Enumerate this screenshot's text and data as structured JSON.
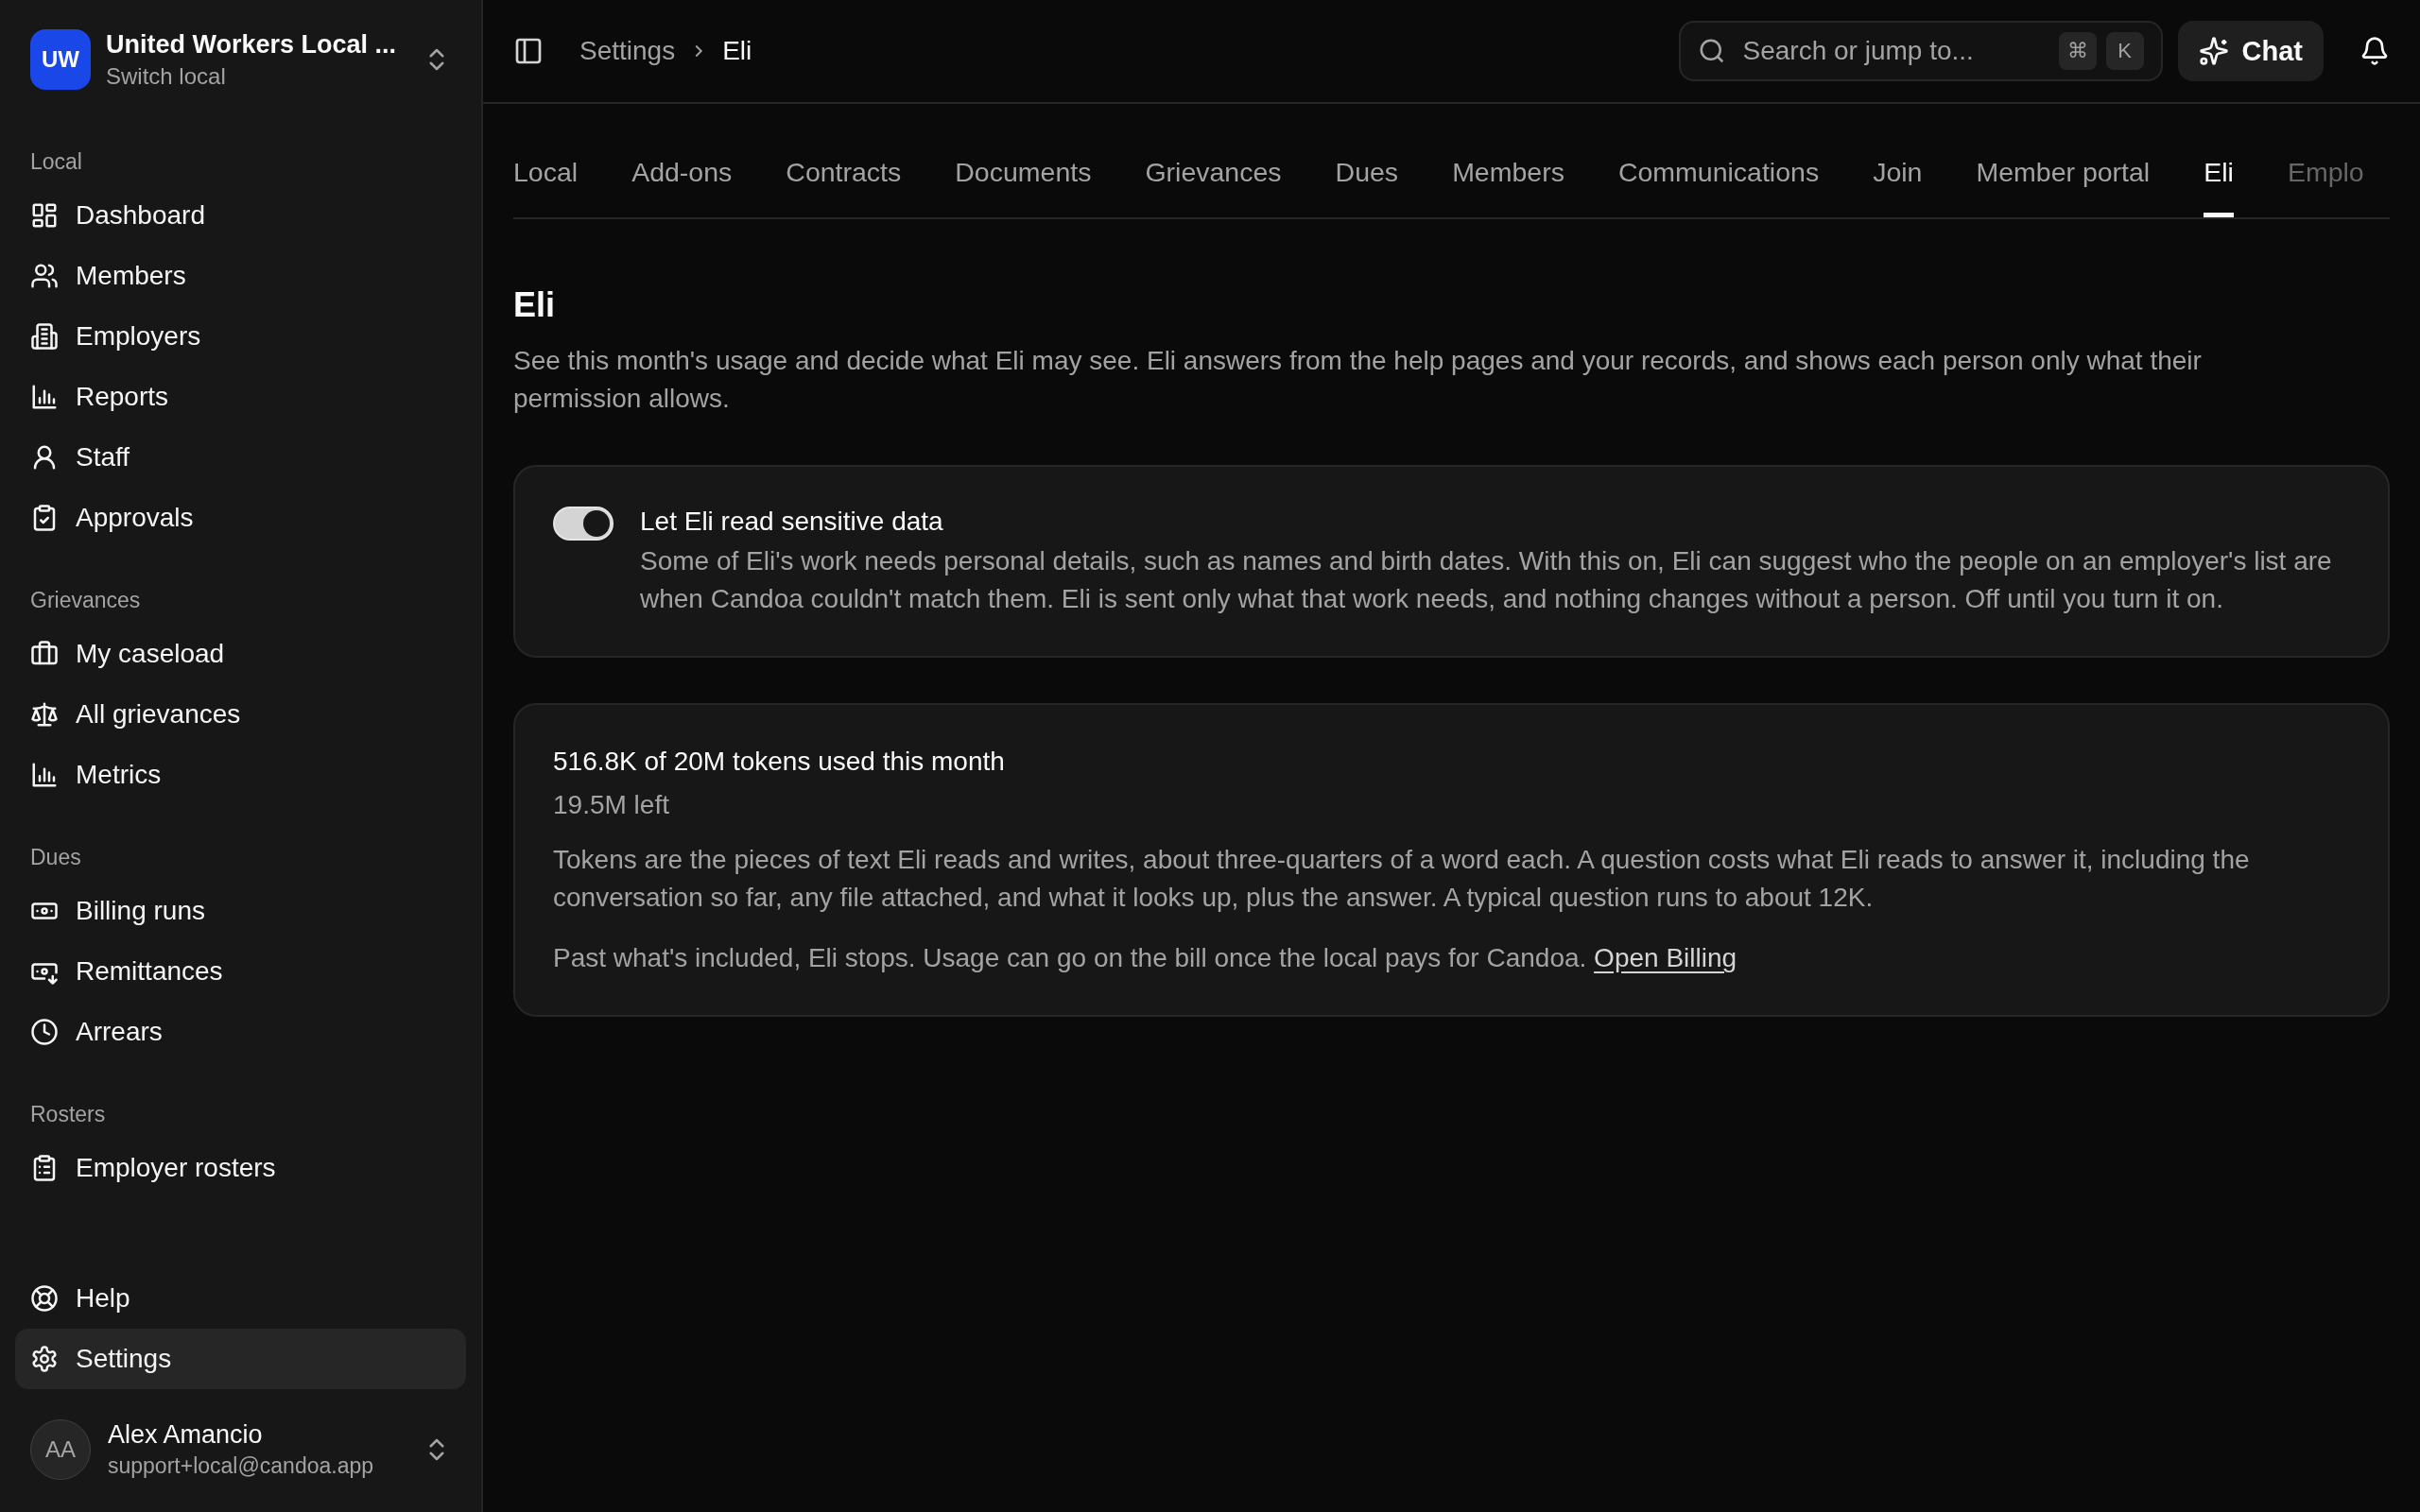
{
  "workspace": {
    "initials": "UW",
    "name": "United Workers Local ...",
    "subtitle": "Switch local"
  },
  "sidebar": {
    "sections": [
      {
        "label": "Local",
        "items": [
          {
            "label": "Dashboard",
            "selected": false
          },
          {
            "label": "Members",
            "selected": false
          },
          {
            "label": "Employers",
            "selected": false
          },
          {
            "label": "Reports",
            "selected": false
          },
          {
            "label": "Staff",
            "selected": false
          },
          {
            "label": "Approvals",
            "selected": false
          }
        ]
      },
      {
        "label": "Grievances",
        "items": [
          {
            "label": "My caseload",
            "selected": false
          },
          {
            "label": "All grievances",
            "selected": false
          },
          {
            "label": "Metrics",
            "selected": false
          }
        ]
      },
      {
        "label": "Dues",
        "items": [
          {
            "label": "Billing runs",
            "selected": false
          },
          {
            "label": "Remittances",
            "selected": false
          },
          {
            "label": "Arrears",
            "selected": false
          }
        ]
      },
      {
        "label": "Rosters",
        "items": [
          {
            "label": "Employer rosters",
            "selected": false
          }
        ]
      }
    ],
    "footer_items": [
      {
        "label": "Help",
        "selected": false
      },
      {
        "label": "Settings",
        "selected": true
      }
    ]
  },
  "user": {
    "initials": "AA",
    "name": "Alex Amancio",
    "email": "support+local@candoa.app"
  },
  "topbar": {
    "breadcrumb": [
      "Settings",
      "Eli"
    ],
    "search": {
      "placeholder": "Search or jump to...",
      "keys": [
        "⌘",
        "K"
      ]
    },
    "chat_button": "Chat"
  },
  "tabs": [
    {
      "label": "Local",
      "selected": false
    },
    {
      "label": "Add-ons",
      "selected": false
    },
    {
      "label": "Contracts",
      "selected": false
    },
    {
      "label": "Documents",
      "selected": false
    },
    {
      "label": "Grievances",
      "selected": false
    },
    {
      "label": "Dues",
      "selected": false
    },
    {
      "label": "Members",
      "selected": false
    },
    {
      "label": "Communications",
      "selected": false
    },
    {
      "label": "Join",
      "selected": false
    },
    {
      "label": "Member portal",
      "selected": false
    },
    {
      "label": "Eli",
      "selected": true
    },
    {
      "label": "Emplo",
      "selected": false
    }
  ],
  "page": {
    "title": "Eli",
    "description": "See this month's usage and decide what Eli may see. Eli answers from the help pages and your records, and shows each person only what their permission allows."
  },
  "settings": [
    {
      "kind": "toggle",
      "label": "Let Eli read sensitive data",
      "description": "Some of Eli's work needs personal details, such as names and birth dates. With this on, Eli can suggest who the people on an employer's list are when Candoa couldn't match them. Eli is sent only what that work needs, and nothing changes without a person. Off until you turn it on.",
      "on": true
    }
  ],
  "usage": {
    "title": "516.8K of 20M tokens used this month",
    "remaining": "19.5M left",
    "explanation": "Tokens are the pieces of text Eli reads and writes, about three-quarters of a word each. A question costs what Eli reads to answer it, including the conversation so far, any file attached, and what it looks up, plus the answer. A typical question runs to about 12K.",
    "note": "Past what's included, Eli stops. Usage can go on the bill once the local pays for Candoa.",
    "link": "Open Billing"
  }
}
